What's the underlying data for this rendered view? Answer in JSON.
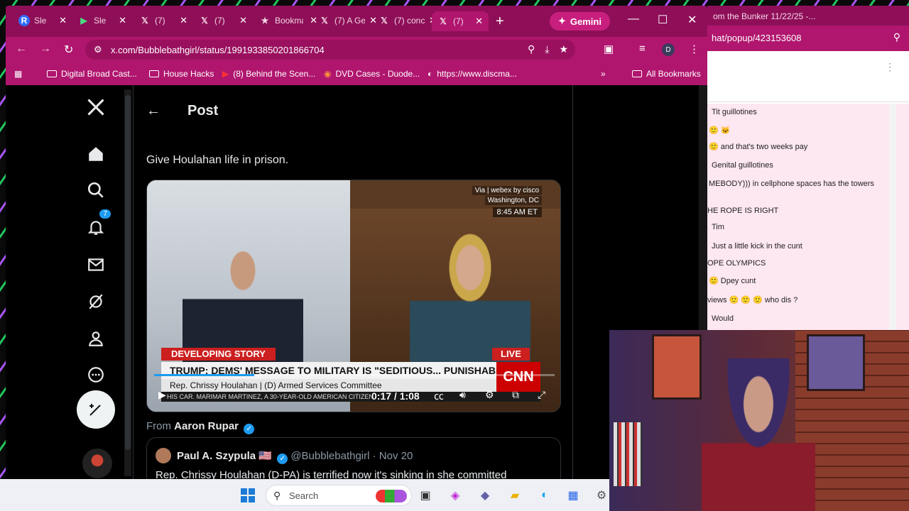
{
  "browser": {
    "tabs": [
      {
        "label": "Sle",
        "icon": "R"
      },
      {
        "label": "Sle",
        "icon": "▶"
      },
      {
        "label": "(7)",
        "icon": "𝕏"
      },
      {
        "label": "(7)",
        "icon": "𝕏"
      },
      {
        "label": "Bookma",
        "icon": "★"
      },
      {
        "label": "(7) A Ge",
        "icon": "𝕏"
      },
      {
        "label": "(7) conc",
        "icon": "𝕏"
      },
      {
        "label": "(7)",
        "icon": "𝕏"
      }
    ],
    "gemini_label": "Gemini",
    "url": "x.com/Bubblebathgirl/status/1991933850201866704",
    "profile_initial": "D",
    "bookmarks": [
      {
        "label": "Digital Broad Cast..."
      },
      {
        "label": "House Hacks"
      },
      {
        "label": "(8) Behind the Scen..."
      },
      {
        "label": "DVD Cases - Duode..."
      },
      {
        "label": "https://www.discma..."
      }
    ],
    "all_bookmarks": "All Bookmarks"
  },
  "sidenav": {
    "notification_count": "7"
  },
  "post": {
    "header_title": "Post",
    "text": "Give Houlahan life in prison.",
    "video": {
      "via": "Via | webex by cisco",
      "location": "Washington, DC",
      "clock": "8:45 AM ET",
      "developing": "DEVELOPING STORY",
      "live": "LIVE",
      "chyron": "TRUMP: DEMS' MESSAGE TO MILITARY IS \"SEDITIOUS... PUNISHABLE BY DEATH\"",
      "name_line": "Rep. Chrissy Houlahan  |  (D) Armed Services Committee",
      "network": "CNN",
      "ticker": "HIS CAR. MARIMAR MARTINEZ, A 30-YEAR-OLD AMERICAN CITIZEN",
      "timecode": "0:17 / 1:08",
      "progress": 0.25
    },
    "from_prefix": "From",
    "from_name": "Aaron Rupar",
    "quote": {
      "name": "Paul A. Szypula 🇺🇸",
      "handle": "@Bubblebathgirl · Nov 20",
      "text": "Rep. Chrissy Houlahan (D-PA) is terrified now it's sinking in she committed"
    }
  },
  "chat": {
    "title": "om the Bunker 11/22/25 -...",
    "address": "hat/popup/423153608",
    "messages": [
      "Tit guillotines",
      "🙂 🐱",
      "🙂 and that's two weeks pay",
      "Genital guillotines",
      "MEBODY))) in cellphone spaces has the towers",
      "HE ROPE IS RIGHT",
      "Tim",
      "Just a little kick in the cunt",
      "OPE OLYMPICS",
      "🙂 Dpey cunt",
      "views 🙂 🙂 🙂 who dis ?",
      "Would"
    ]
  },
  "taskbar": {
    "search_placeholder": "Search"
  }
}
